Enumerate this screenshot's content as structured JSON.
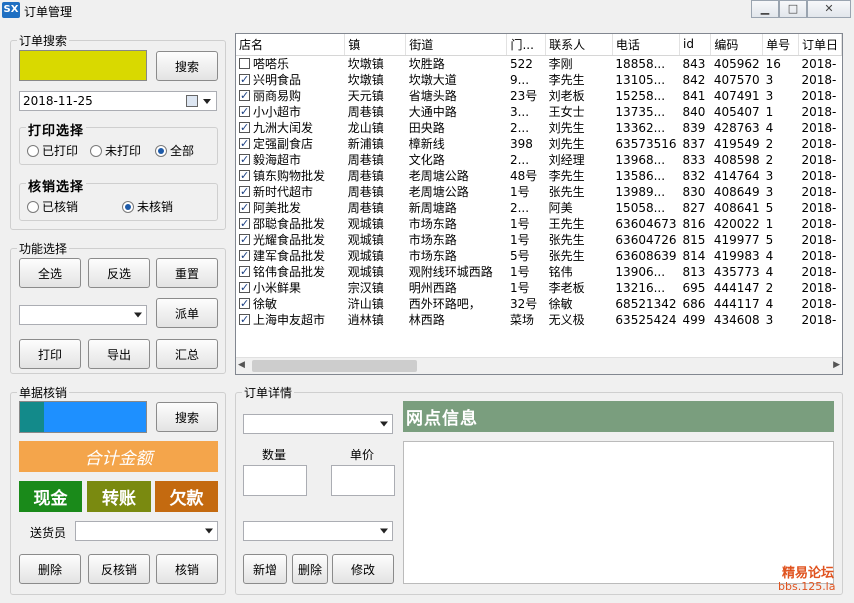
{
  "window": {
    "title": "订单管理",
    "icon_text": "SX",
    "buttons": [
      "minimize-icon",
      "maximize-icon",
      "close-icon"
    ]
  },
  "order_search": {
    "label": "订单搜索",
    "search_button": "搜索",
    "date_value": "2018-11-25",
    "print_group": {
      "label": "打印选择",
      "options": [
        "已打印",
        "未打印",
        "全部"
      ],
      "selected": "全部"
    },
    "verify_group": {
      "label": "核销选择",
      "options": [
        "已核销",
        "未核销"
      ],
      "selected": "未核销"
    }
  },
  "functions": {
    "label": "功能选择",
    "select_all": "全选",
    "invert": "反选",
    "reset": "重置",
    "dispatch": "派单",
    "print": "打印",
    "export": "导出",
    "summary": "汇总"
  },
  "table": {
    "columns": [
      "店名",
      "镇",
      "街道",
      "门...",
      "联系人",
      "电话",
      "id",
      "编码",
      "单号",
      "订单日"
    ],
    "rows": [
      {
        "checked": false,
        "cells": [
          "嗒嗒乐",
          "坎墩镇",
          "坎胜路",
          "522",
          "李刚",
          "18858...",
          "843",
          "405962",
          "16",
          "2018-"
        ]
      },
      {
        "checked": true,
        "cells": [
          "兴明食品",
          "坎墩镇",
          "坎墩大道",
          "9...",
          "李先生",
          "13105...",
          "842",
          "407570",
          "3",
          "2018-"
        ]
      },
      {
        "checked": true,
        "cells": [
          "丽商易购",
          "天元镇",
          "省塘头路",
          "23号",
          "刘老板",
          "15258...",
          "841",
          "407491",
          "3",
          "2018-"
        ]
      },
      {
        "checked": true,
        "cells": [
          "小小超市",
          "周巷镇",
          "大通中路",
          "3...",
          "王女士",
          "13735...",
          "840",
          "405407",
          "1",
          "2018-"
        ]
      },
      {
        "checked": true,
        "cells": [
          "九洲大闰发",
          "龙山镇",
          "田央路",
          "2...",
          "刘先生",
          "13362...",
          "839",
          "428763",
          "4",
          "2018-"
        ]
      },
      {
        "checked": true,
        "cells": [
          "定强副食店",
          "新浦镇",
          "樟新线",
          "398",
          "刘先生",
          "63573516",
          "837",
          "419549",
          "2",
          "2018-"
        ]
      },
      {
        "checked": true,
        "cells": [
          "毅海超市",
          "周巷镇",
          "文化路",
          "2...",
          "刘经理",
          "13968...",
          "833",
          "408598",
          "2",
          "2018-"
        ]
      },
      {
        "checked": true,
        "cells": [
          "镇东购物批发",
          "周巷镇",
          "老周塘公路",
          "48号",
          "李先生",
          "13586...",
          "832",
          "414764",
          "3",
          "2018-"
        ]
      },
      {
        "checked": true,
        "cells": [
          "新时代超市",
          "周巷镇",
          "老周塘公路",
          "1号",
          "张先生",
          "13989...",
          "830",
          "408649",
          "3",
          "2018-"
        ]
      },
      {
        "checked": true,
        "cells": [
          "阿美批发",
          "周巷镇",
          "新周塘路",
          "2...",
          "阿美",
          "15058...",
          "827",
          "408641",
          "5",
          "2018-"
        ]
      },
      {
        "checked": true,
        "cells": [
          "邵聪食品批发",
          "观城镇",
          "市场东路",
          "1号",
          "王先生",
          "63604673",
          "816",
          "420022",
          "1",
          "2018-"
        ]
      },
      {
        "checked": true,
        "cells": [
          "光耀食品批发",
          "观城镇",
          "市场东路",
          "1号",
          "张先生",
          "63604726",
          "815",
          "419977",
          "5",
          "2018-"
        ]
      },
      {
        "checked": true,
        "cells": [
          "建军食品批发",
          "观城镇",
          "市场东路",
          "5号",
          "张先生",
          "63608639",
          "814",
          "419983",
          "4",
          "2018-"
        ]
      },
      {
        "checked": true,
        "cells": [
          "铭伟食品批发",
          "观城镇",
          "观附线环城西路",
          "1号",
          "铭伟",
          "13906...",
          "813",
          "435773",
          "4",
          "2018-"
        ]
      },
      {
        "checked": true,
        "cells": [
          "小米鲜果",
          "宗汉镇",
          "明州西路",
          "1号",
          "李老板",
          "13216...",
          "695",
          "444147",
          "2",
          "2018-"
        ]
      },
      {
        "checked": true,
        "cells": [
          "徐敏",
          "浒山镇",
          "西外环路吧，",
          "32号",
          "徐敏",
          "68521342",
          "686",
          "444117",
          "4",
          "2018-"
        ]
      },
      {
        "checked": true,
        "cells": [
          "上海申友超市",
          "逍林镇",
          "林西路",
          "菜场",
          "无义极",
          "63525424",
          "499",
          "434608",
          "3",
          "2018-"
        ]
      }
    ]
  },
  "bill_verify": {
    "label": "单据核销",
    "search_button": "搜索",
    "total_label": "合计金额",
    "cash_label": "现金",
    "transfer_label": "转账",
    "debt_label": "欠款",
    "courier_label": "送货员",
    "delete": "删除",
    "unverify": "反核销",
    "verify": "核销"
  },
  "order_detail": {
    "label": "订单详情",
    "qty_label": "数量",
    "price_label": "单价",
    "outlet_title": "网点信息",
    "add": "新增",
    "delete": "删除",
    "modify": "修改"
  },
  "watermark": {
    "line1": "精易论坛",
    "line2": "bbs.125.la"
  },
  "colors": {
    "yellow_box": "#d9d900",
    "teal": "#138a8a",
    "blue": "#1e90ff",
    "orange": "#f4a54b",
    "green": "#1a8a1a",
    "olive": "#7a8a10",
    "rust": "#c46a10",
    "outlet_bg": "#7a9e7e"
  }
}
